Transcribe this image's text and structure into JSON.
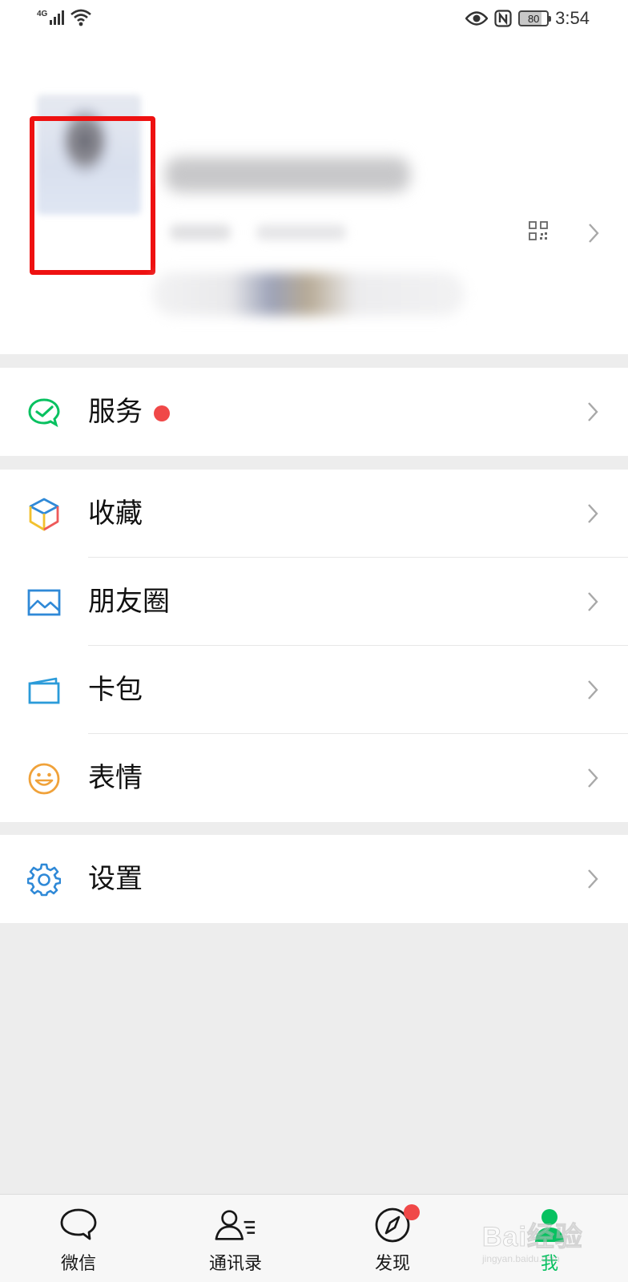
{
  "status_bar": {
    "network": "4G",
    "battery": "80",
    "time": "3:54"
  },
  "profile": {
    "avatar_highlight_color": "#ee1111"
  },
  "menu": {
    "service": {
      "label": "服务",
      "icon": "wechat-pay-check-icon",
      "color": "#07c160",
      "has_badge": true
    },
    "favorites": {
      "label": "收藏",
      "icon": "cube-icon"
    },
    "moments": {
      "label": "朋友圈",
      "icon": "landscape-photo-icon",
      "color": "#2f89d7"
    },
    "cards": {
      "label": "卡包",
      "icon": "wallet-card-icon",
      "color": "#2b9bd9"
    },
    "stickers": {
      "label": "表情",
      "icon": "smiley-face-icon",
      "color": "#f0a23a"
    },
    "settings": {
      "label": "设置",
      "icon": "gear-icon",
      "color": "#2f89d7"
    }
  },
  "tabbar": {
    "chats": {
      "label": "微信",
      "icon": "chat-bubble-icon"
    },
    "contacts": {
      "label": "通讯录",
      "icon": "contacts-icon"
    },
    "discover": {
      "label": "发现",
      "icon": "compass-icon",
      "has_badge": true
    },
    "me": {
      "label": "我",
      "icon": "person-icon",
      "active": true
    }
  },
  "colors": {
    "accent": "#07c160",
    "badge": "#f04848",
    "background": "#ededed"
  },
  "watermark": {
    "text": "Bai经验",
    "sub": "jingyan.baidu.com"
  }
}
